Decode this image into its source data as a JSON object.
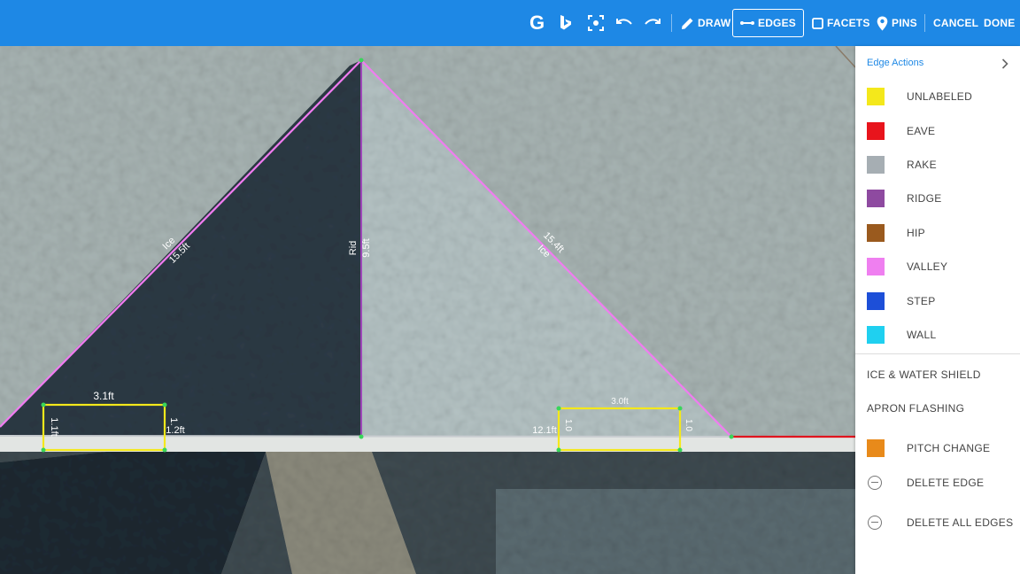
{
  "toolbar": {
    "google_icon": "G",
    "bing_icon": "bing-logo",
    "draw_label": "DRAW",
    "edges_label": "EDGES",
    "facets_label": "FACETS",
    "pins_label": "PINS",
    "cancel_label": "CANCEL",
    "done_label": "DONE"
  },
  "canvas": {
    "labels": {
      "left_rake_type": "Ice",
      "left_rake_len": "15.5ft",
      "ridge_type": "Rid",
      "ridge_len": "9.5ft",
      "right_rake_len": "15.4ft",
      "right_rake_type": "Ice",
      "box1_top": "3.1ft",
      "box1_right": "1.2ft",
      "box1_left": "1.1ft",
      "box1_right2": "1.",
      "box2_top": "3.0ft",
      "box2_left": "12.1ft",
      "box2_left2": "1.0",
      "box2_right": "1.0"
    },
    "colors": {
      "valley": "#f07cf0",
      "ridge": "#9c46b8",
      "unlabeled": "#f4e81b",
      "eave": "#e0141e",
      "rake": "#c8ccd0",
      "vertex": "#39d65a"
    }
  },
  "panel": {
    "title": "Edge Actions",
    "items": [
      {
        "label": "UNLABELED",
        "color": "#f4e81b"
      },
      {
        "label": "EAVE",
        "color": "#e8141c"
      },
      {
        "label": "RAKE",
        "color": "#a6aeb3"
      },
      {
        "label": "RIDGE",
        "color": "#8e4aa0"
      },
      {
        "label": "HIP",
        "color": "#9a5a1e"
      },
      {
        "label": "VALLEY",
        "color": "#ef7ff0"
      },
      {
        "label": "STEP",
        "color": "#1d4fd8"
      },
      {
        "label": "WALL",
        "color": "#1fd0f0"
      }
    ],
    "ice_water": "ICE & WATER SHIELD",
    "apron": "APRON FLASHING",
    "pitch_change": {
      "label": "PITCH CHANGE",
      "color": "#e88a1a"
    },
    "delete_edge": "DELETE EDGE",
    "delete_all": "DELETE ALL EDGES"
  }
}
